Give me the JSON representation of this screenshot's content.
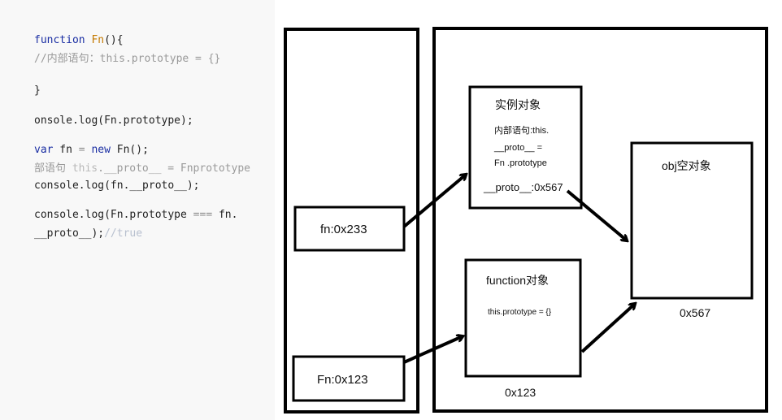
{
  "code": {
    "line1": {
      "kw": "function",
      "name": "Fn",
      "rest": "(){"
    },
    "line2": "//内部语句：this.prototype = {}",
    "line3": "}",
    "line4": "onsole.log(Fn.prototype);",
    "line5": {
      "kw": "var",
      "mid": " fn ",
      "eq": "=",
      "kw2": " new",
      "rest": " Fn();"
    },
    "line6": {
      "a": "部语句 ",
      "b": "this",
      "c": ".__proto__ = Fnprototype"
    },
    "line7": "console.log(fn.__proto__);",
    "line8": {
      "a": "console.log(Fn.prototype ",
      "op": "===",
      "b": " fn."
    },
    "line9": {
      "a": "__proto__);",
      "b": "//true"
    }
  },
  "diagram": {
    "fn_var": "fn:0x233",
    "Fn_var": "Fn:0x123",
    "instance_title": "实例对象",
    "instance_line1": "内部语句:this.",
    "instance_line2": "__proto__ =",
    "instance_line3": "Fn .prototype",
    "instance_proto": "__proto__:0x567",
    "function_title": "function对象",
    "function_prop": "this.prototype = {}",
    "function_addr": "0x123",
    "obj_title": "obj空对象",
    "obj_addr": "0x567"
  }
}
